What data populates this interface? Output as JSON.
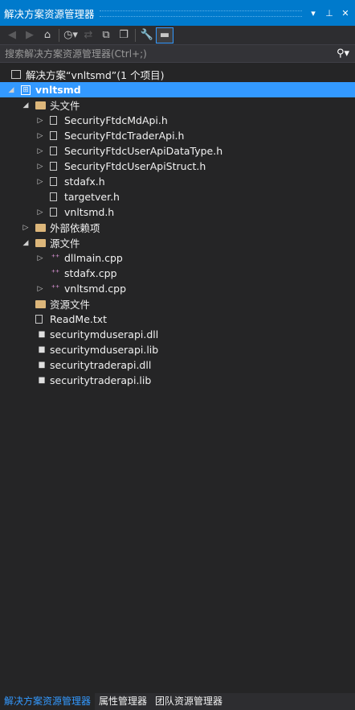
{
  "title": "解决方案资源管理器",
  "title_buttons": [
    "▾",
    "⊥",
    "✕"
  ],
  "search": {
    "placeholder": "搜索解决方案资源管理器(Ctrl+;)"
  },
  "tree": [
    {
      "label": "解决方案“vnltsmd”(1 个项目)",
      "icon": "solution-icon",
      "level": 0,
      "arrow": "",
      "name": "tree-item-solution"
    },
    {
      "label": "vnltsmd",
      "icon": "project-icon",
      "level": 0,
      "arrow": "down",
      "name": "tree-item-project",
      "selected": true
    },
    {
      "label": "头文件",
      "icon": "folder-icon",
      "level": 1,
      "arrow": "down",
      "name": "tree-item-header-files"
    },
    {
      "label": "SecurityFtdcMdApi.h",
      "icon": "header-file-icon",
      "level": 2,
      "arrow": "right",
      "name": "tree-item-file"
    },
    {
      "label": "SecurityFtdcTraderApi.h",
      "icon": "header-file-icon",
      "level": 2,
      "arrow": "right",
      "name": "tree-item-file"
    },
    {
      "label": "SecurityFtdcUserApiDataType.h",
      "icon": "header-file-icon",
      "level": 2,
      "arrow": "right",
      "name": "tree-item-file"
    },
    {
      "label": "SecurityFtdcUserApiStruct.h",
      "icon": "header-file-icon",
      "level": 2,
      "arrow": "right",
      "name": "tree-item-file"
    },
    {
      "label": "stdafx.h",
      "icon": "header-file-icon",
      "level": 2,
      "arrow": "right",
      "name": "tree-item-file"
    },
    {
      "label": "targetver.h",
      "icon": "header-file-icon",
      "level": 2,
      "arrow": "",
      "name": "tree-item-file"
    },
    {
      "label": "vnltsmd.h",
      "icon": "header-file-icon",
      "level": 2,
      "arrow": "right",
      "name": "tree-item-file"
    },
    {
      "label": "外部依赖项",
      "icon": "dependencies-icon",
      "level": 1,
      "arrow": "right",
      "name": "tree-item-external-deps"
    },
    {
      "label": "源文件",
      "icon": "folder-icon",
      "level": 1,
      "arrow": "down",
      "name": "tree-item-source-files"
    },
    {
      "label": "dllmain.cpp",
      "icon": "cpp-file-icon",
      "level": 2,
      "arrow": "right",
      "name": "tree-item-file"
    },
    {
      "label": "stdafx.cpp",
      "icon": "cpp-file-icon",
      "level": 2,
      "arrow": "",
      "name": "tree-item-file"
    },
    {
      "label": "vnltsmd.cpp",
      "icon": "cpp-file-icon",
      "level": 2,
      "arrow": "right",
      "name": "tree-item-file"
    },
    {
      "label": "资源文件",
      "icon": "folder-icon",
      "level": 1,
      "arrow": "",
      "name": "tree-item-resource-files"
    },
    {
      "label": "ReadMe.txt",
      "icon": "text-file-icon",
      "level": 1,
      "arrow": "",
      "name": "tree-item-file"
    },
    {
      "label": "securitymduserapi.dll",
      "icon": "library-icon",
      "level": 1,
      "arrow": "",
      "name": "tree-item-file"
    },
    {
      "label": "securitymduserapi.lib",
      "icon": "library-icon",
      "level": 1,
      "arrow": "",
      "name": "tree-item-file"
    },
    {
      "label": "securitytraderapi.dll",
      "icon": "library-icon",
      "level": 1,
      "arrow": "",
      "name": "tree-item-file"
    },
    {
      "label": "securitytraderapi.lib",
      "icon": "library-icon",
      "level": 1,
      "arrow": "",
      "name": "tree-item-file"
    }
  ],
  "bottom_tabs": [
    "解决方案资源管理器",
    "属性管理器",
    "团队资源管理器"
  ],
  "colors": {
    "accent": "#007acc",
    "selection": "#3399ff",
    "background": "#252526",
    "folder": "#dcb67a"
  }
}
